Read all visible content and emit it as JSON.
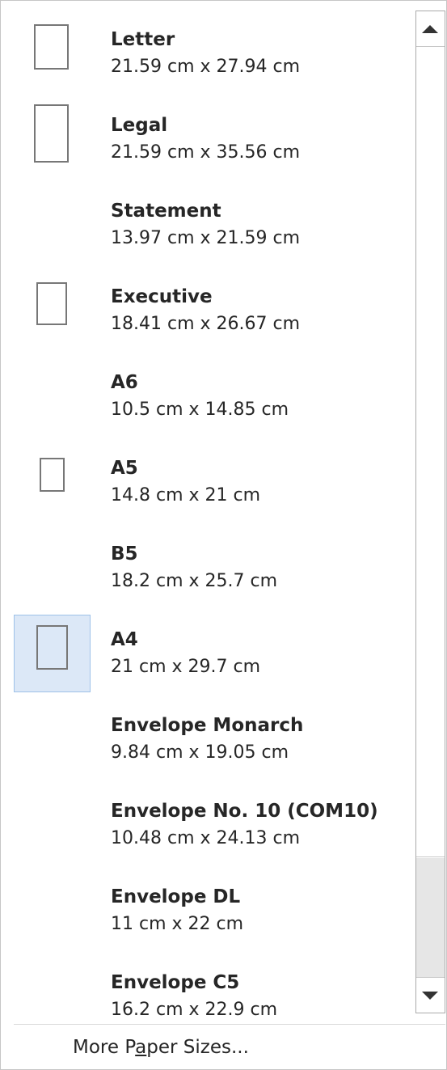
{
  "paper_sizes": [
    {
      "name": "Letter",
      "size": "21.59 cm x 27.94 cm",
      "has_icon": true,
      "selected": false
    },
    {
      "name": "Legal",
      "size": "21.59 cm x 35.56 cm",
      "has_icon": true,
      "selected": false
    },
    {
      "name": "Statement",
      "size": "13.97 cm x 21.59 cm",
      "has_icon": false,
      "selected": false
    },
    {
      "name": "Executive",
      "size": "18.41 cm x 26.67 cm",
      "has_icon": true,
      "selected": false
    },
    {
      "name": "A6",
      "size": "10.5 cm x 14.85 cm",
      "has_icon": false,
      "selected": false
    },
    {
      "name": "A5",
      "size": "14.8 cm x 21 cm",
      "has_icon": true,
      "selected": false
    },
    {
      "name": "B5",
      "size": "18.2 cm x 25.7 cm",
      "has_icon": false,
      "selected": false
    },
    {
      "name": "A4",
      "size": "21 cm x 29.7 cm",
      "has_icon": true,
      "selected": true
    },
    {
      "name": "Envelope Monarch",
      "size": "9.84 cm x 19.05 cm",
      "has_icon": false,
      "selected": false
    },
    {
      "name": "Envelope No. 10 (COM10)",
      "size": "10.48 cm x 24.13 cm",
      "has_icon": false,
      "selected": false
    },
    {
      "name": "Envelope DL",
      "size": "11 cm x 22 cm",
      "has_icon": false,
      "selected": false
    },
    {
      "name": "Envelope C5",
      "size": "16.2 cm x 22.9 cm",
      "has_icon": false,
      "selected": false
    }
  ],
  "more_paper_sizes": {
    "before": "More P",
    "accesskey": "a",
    "after": "per Sizes..."
  },
  "colors": {
    "selected_bg": "#dce8f7",
    "selected_border": "#9ec1e8",
    "icon_stroke": "#777777"
  },
  "icons": {
    "scroll_up": "triangle-up-icon",
    "scroll_down": "triangle-down-icon",
    "paper": "paper-outline-icon"
  }
}
